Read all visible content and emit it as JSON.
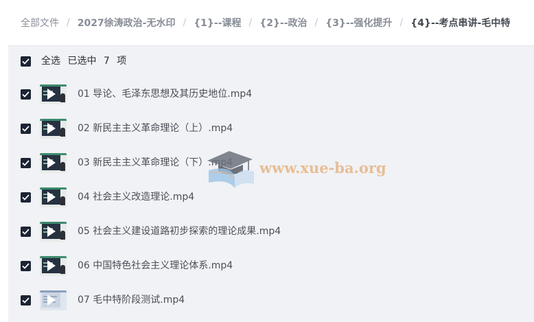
{
  "breadcrumb": {
    "root": "全部文件",
    "items": [
      "2027徐涛政治-无水印",
      "{1}--课程",
      "{2}--政治",
      "{3}--强化提升"
    ],
    "current": "{4}--考点串讲-毛中特",
    "separator": "/"
  },
  "selection": {
    "select_all_label": "全选",
    "selected_prefix": "已选中",
    "selected_count": "7",
    "selected_suffix": "项",
    "checked": true
  },
  "files": [
    {
      "name": "01 导论、毛泽东思想及其历史地位.mp4",
      "checked": true,
      "thumb": "video-dark"
    },
    {
      "name": "02 新民主主义革命理论（上）.mp4",
      "checked": true,
      "thumb": "video-dark"
    },
    {
      "name": "03 新民主主义革命理论（下）.mp4",
      "checked": true,
      "thumb": "video-dark"
    },
    {
      "name": "04 社会主义改造理论.mp4",
      "checked": true,
      "thumb": "video-dark"
    },
    {
      "name": "05 社会主义建设道路初步探索的理论成果.mp4",
      "checked": true,
      "thumb": "video-dark"
    },
    {
      "name": "06 中国特色社会主义理论体系.mp4",
      "checked": true,
      "thumb": "video-dark"
    },
    {
      "name": "07 毛中特阶段测试.mp4",
      "checked": true,
      "thumb": "video-light"
    }
  ],
  "watermark": {
    "text": "www.xue-ba.org",
    "icon": "graduation-cap-book-icon"
  },
  "colors": {
    "checkbox": "#1c2434",
    "panel_bg": "#f1f2f5",
    "watermark": "#e6b98c",
    "thumb_accent": "#3c8b6e"
  }
}
